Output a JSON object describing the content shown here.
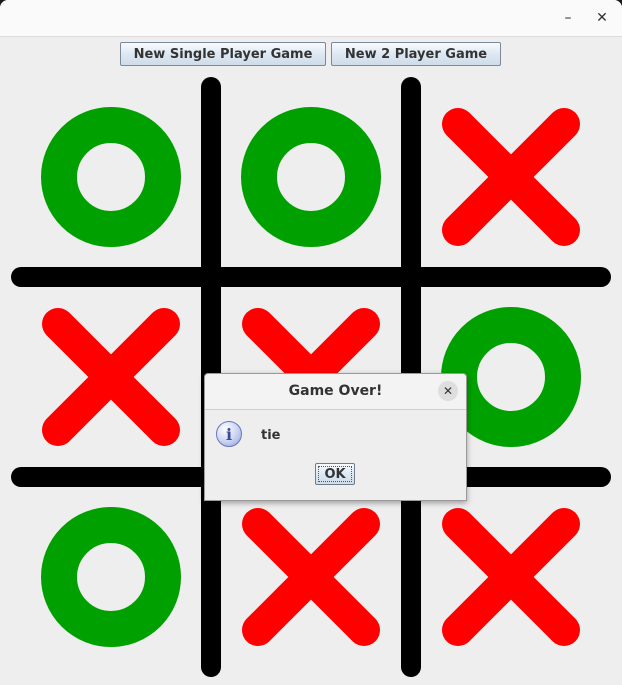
{
  "window": {
    "minimize_glyph": "–",
    "close_glyph": "✕"
  },
  "toolbar": {
    "single_player_label": "New Single Player Game",
    "two_player_label": "New 2 Player Game"
  },
  "board": {
    "cells": [
      [
        "O",
        "O",
        "X"
      ],
      [
        "X",
        "X",
        "O"
      ],
      [
        "O",
        "X",
        "X"
      ]
    ],
    "colors": {
      "grid": "#000000",
      "x": "#ff0000",
      "o": "#00a000"
    }
  },
  "dialog": {
    "title": "Game Over!",
    "icon": "info-icon",
    "message": "tie",
    "ok_label": "OK",
    "close_glyph": "✕"
  }
}
